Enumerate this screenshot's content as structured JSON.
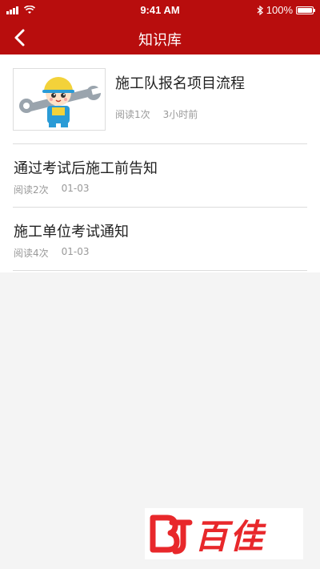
{
  "status_bar": {
    "time": "9:41 AM",
    "battery": "100%",
    "icons": [
      "signal-icon",
      "wifi-icon",
      "bluetooth-icon",
      "battery-icon"
    ]
  },
  "nav": {
    "title": "知识库",
    "back_icon": "chevron-left-icon"
  },
  "articles": [
    {
      "title": "施工队报名项目流程",
      "reads": "阅读1次",
      "time": "3小时前",
      "has_thumbnail": true
    },
    {
      "title": "通过考试后施工前告知",
      "reads": "阅读2次",
      "time": "01-03",
      "has_thumbnail": false
    },
    {
      "title": "施工单位考试通知",
      "reads": "阅读4次",
      "time": "01-03",
      "has_thumbnail": false
    }
  ],
  "watermark": {
    "text": "百佳"
  },
  "colors": {
    "header": "#b80d0d",
    "list_bg": "#ffffff",
    "page_bg": "#f4f4f4",
    "watermark": "#e8282b"
  }
}
